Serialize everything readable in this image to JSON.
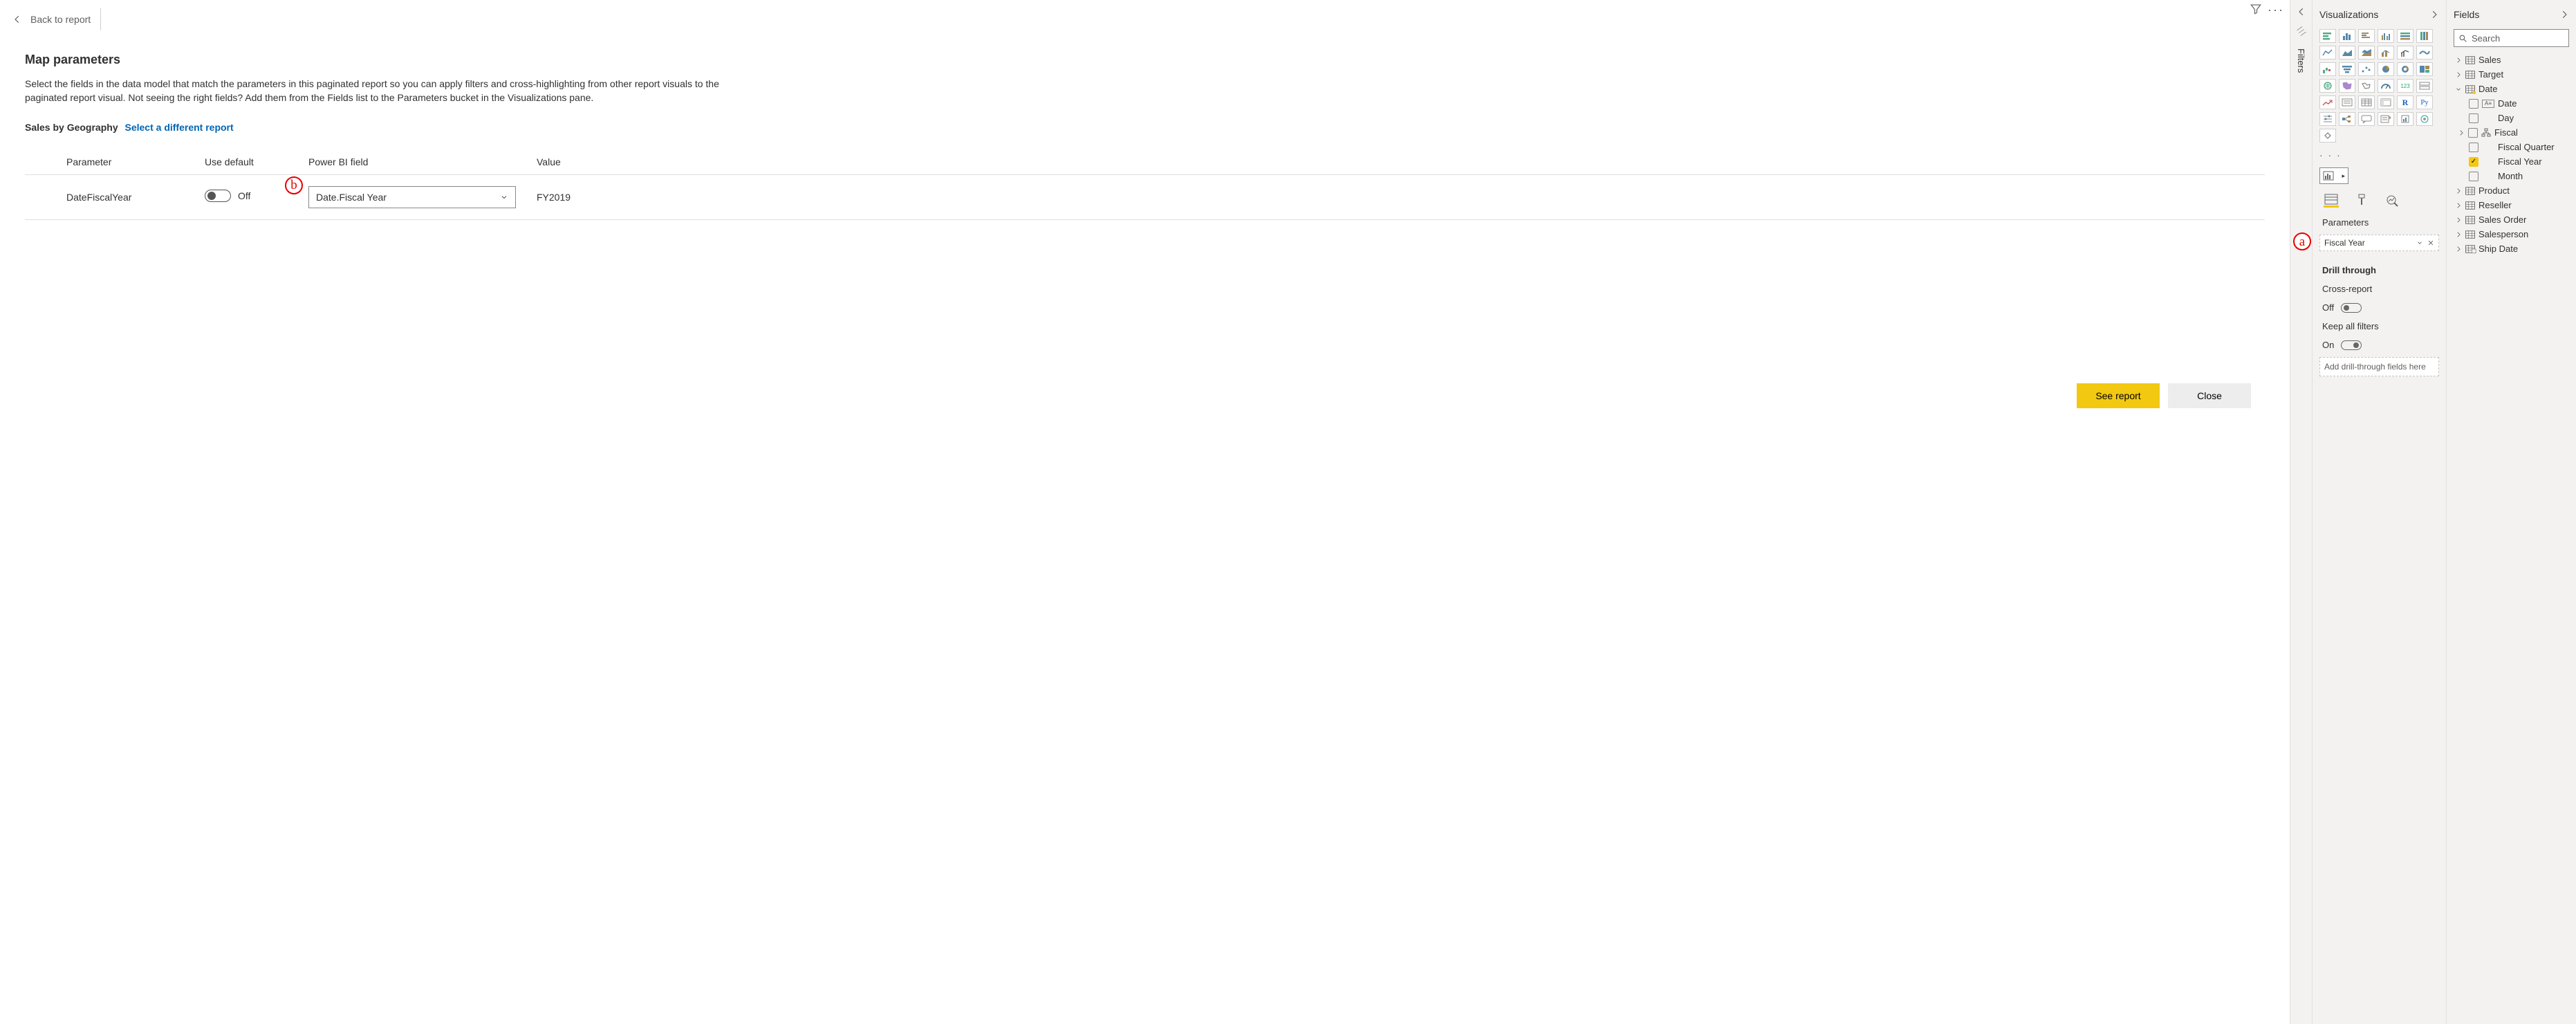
{
  "topbar": {
    "back": "Back to report"
  },
  "map": {
    "title": "Map parameters",
    "desc": "Select the fields in the data model that match the parameters in this paginated report so you can apply filters and cross-highlighting from other report visuals to the paginated report visual. Not seeing the right fields? Add them from the Fields list to the Parameters bucket in the Visualizations pane.",
    "report_name": "Sales by Geography",
    "select_different": "Select a different report",
    "headers": {
      "param": "Parameter",
      "def": "Use default",
      "field": "Power BI field",
      "value": "Value"
    },
    "rows": [
      {
        "param": "DateFiscalYear",
        "default_state": "Off",
        "field": "Date.Fiscal Year",
        "value": "FY2019"
      }
    ],
    "buttons": {
      "see": "See report",
      "close": "Close"
    },
    "annot_a": "a",
    "annot_b": "b"
  },
  "filters_label": "Filters",
  "viz": {
    "title": "Visualizations",
    "parameters": "Parameters",
    "param_field": "Fiscal Year",
    "drill": "Drill through",
    "cross": "Cross-report",
    "cross_state": "Off",
    "keep": "Keep all filters",
    "keep_state": "On",
    "dt_well": "Add drill-through fields here"
  },
  "fields": {
    "title": "Fields",
    "search": "Search",
    "tables": [
      "Sales",
      "Target",
      "Date",
      "Product",
      "Reseller",
      "Sales Order",
      "Salesperson",
      "Ship Date"
    ],
    "date_children": [
      {
        "label": "Date",
        "type": "date",
        "checked": false
      },
      {
        "label": "Day",
        "type": "none",
        "checked": false
      },
      {
        "label": "Fiscal",
        "type": "hier",
        "checked": false,
        "hasCaret": true
      },
      {
        "label": "Fiscal Quarter",
        "type": "none",
        "checked": false
      },
      {
        "label": "Fiscal Year",
        "type": "none",
        "checked": true
      },
      {
        "label": "Month",
        "type": "none",
        "checked": false
      }
    ]
  }
}
